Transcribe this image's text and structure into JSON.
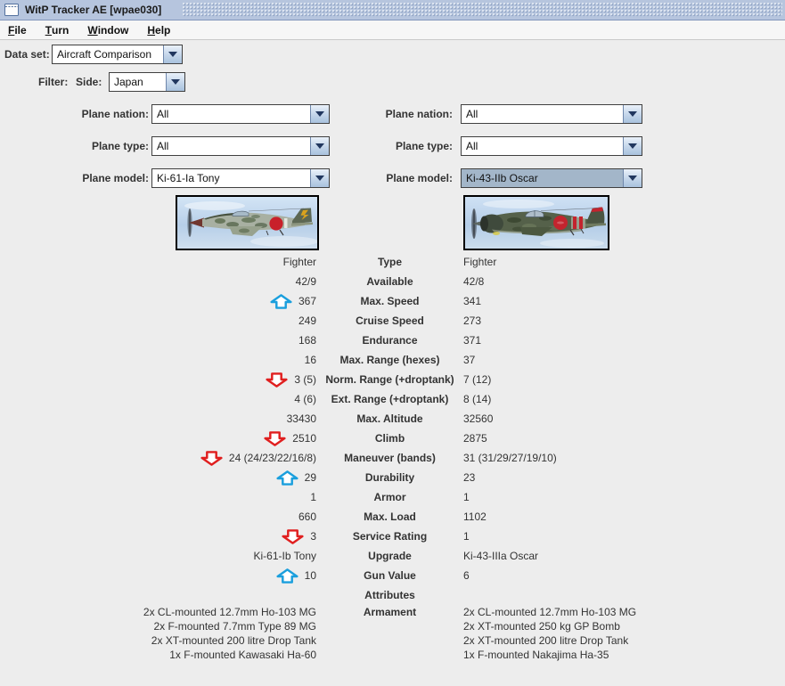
{
  "window": {
    "title": "WitP Tracker AE [wpae030]"
  },
  "menu": {
    "items": [
      {
        "label": "File"
      },
      {
        "label": "Turn"
      },
      {
        "label": "Window"
      },
      {
        "label": "Help"
      }
    ]
  },
  "dataset": {
    "label": "Data set:",
    "value": "Aircraft Comparison"
  },
  "filter": {
    "label": "Filter:",
    "side_label": "Side:",
    "side_value": "Japan"
  },
  "left_panel": {
    "nation_label": "Plane nation:",
    "nation_value": "All",
    "type_label": "Plane type:",
    "type_value": "All",
    "model_label": "Plane model:",
    "model_value": "Ki-61-Ia Tony"
  },
  "right_panel": {
    "nation_label": "Plane nation:",
    "nation_value": "All",
    "type_label": "Plane type:",
    "type_value": "All",
    "model_label": "Plane model:",
    "model_value": "Ki-43-IIb Oscar"
  },
  "comparison": {
    "rows": [
      {
        "label": "Type",
        "left": "Fighter",
        "right": "Fighter",
        "arrow": null
      },
      {
        "label": "Available",
        "left": "42/9",
        "right": "42/8",
        "arrow": null
      },
      {
        "label": "Max. Speed",
        "left": "367",
        "right": "341",
        "arrow": "up"
      },
      {
        "label": "Cruise Speed",
        "left": "249",
        "right": "273",
        "arrow": null
      },
      {
        "label": "Endurance",
        "left": "168",
        "right": "371",
        "arrow": null
      },
      {
        "label": "Max. Range (hexes)",
        "left": "16",
        "right": "37",
        "arrow": null
      },
      {
        "label": "Norm. Range (+droptank)",
        "left": "3 (5)",
        "right": "7 (12)",
        "arrow": "down"
      },
      {
        "label": "Ext. Range (+droptank)",
        "left": "4 (6)",
        "right": "8 (14)",
        "arrow": null
      },
      {
        "label": "Max. Altitude",
        "left": "33430",
        "right": "32560",
        "arrow": null
      },
      {
        "label": "Climb",
        "left": "2510",
        "right": "2875",
        "arrow": "down"
      },
      {
        "label": "Maneuver (bands)",
        "left": "24 (24/23/22/16/8)",
        "right": "31 (31/29/27/19/10)",
        "arrow": "down"
      },
      {
        "label": "Durability",
        "left": "29",
        "right": "23",
        "arrow": "up"
      },
      {
        "label": "Armor",
        "left": "1",
        "right": "1",
        "arrow": null
      },
      {
        "label": "Max. Load",
        "left": "660",
        "right": "1102",
        "arrow": null
      },
      {
        "label": "Service Rating",
        "left": "3",
        "right": "1",
        "arrow": "down"
      },
      {
        "label": "Upgrade",
        "left": "Ki-61-Ib Tony",
        "right": "Ki-43-IIIa Oscar",
        "arrow": null
      },
      {
        "label": "Gun Value",
        "left": "10",
        "right": "6",
        "arrow": "up"
      },
      {
        "label": "Attributes",
        "left": "",
        "right": "",
        "arrow": null
      },
      {
        "label": "Armament",
        "left_lines": [
          "2x CL-mounted 12.7mm Ho-103 MG",
          "2x F-mounted 7.7mm Type 89 MG",
          "2x XT-mounted 200 litre Drop Tank",
          "1x F-mounted Kawasaki Ha-60"
        ],
        "right_lines": [
          "2x CL-mounted 12.7mm Ho-103 MG",
          "2x XT-mounted 250 kg GP Bomb",
          "2x XT-mounted 200 litre Drop Tank",
          "1x F-mounted Nakajima Ha-35"
        ],
        "arrow": null
      }
    ]
  },
  "colors": {
    "arrow_up": "#1b9fdd",
    "arrow_down": "#e01f1f",
    "selected_combo_bg": "#a3b6c9",
    "titlebar_bg": "#b6c5de"
  },
  "icons": {
    "app_icon": "window-frame-icon",
    "combo_button": "chevron-down-icon",
    "better": "arrow-up-icon",
    "worse": "arrow-down-icon"
  }
}
